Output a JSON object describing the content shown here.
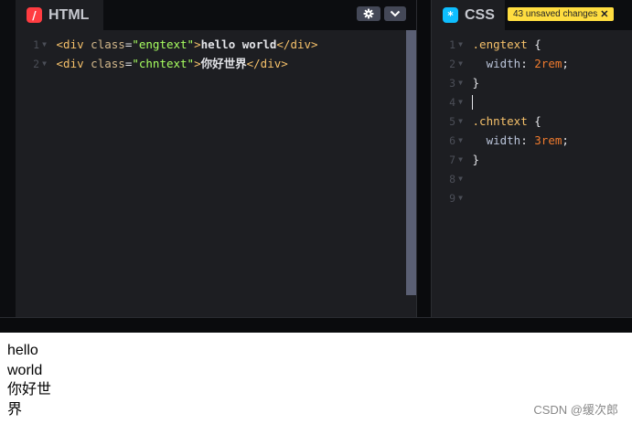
{
  "colors": {
    "tag": "#f5c06a",
    "attr": "#d4b98c",
    "string": "#a8ff60",
    "selector": "#f5c06a",
    "property": "#b9c3d8",
    "value": "#f07b2e",
    "punct": "#e4e5e9",
    "brace": "#e4e5e9",
    "text": "#e4e5e9"
  },
  "html_pane": {
    "title": "HTML",
    "icon": "html-slash-icon",
    "settings_icon": "gear-icon",
    "collapse_icon": "chevron-down-icon",
    "lines": [
      {
        "num": "1",
        "tokens": [
          {
            "t": "<div",
            "c": "tag"
          },
          {
            "t": " ",
            "c": "text"
          },
          {
            "t": "class",
            "c": "attr"
          },
          {
            "t": "=",
            "c": "punct"
          },
          {
            "t": "\"engtext\"",
            "c": "string"
          },
          {
            "t": ">",
            "c": "tag"
          },
          {
            "t": "hello world",
            "c": "text"
          },
          {
            "t": "</div>",
            "c": "tag"
          }
        ]
      },
      {
        "num": "2",
        "tokens": [
          {
            "t": "<div",
            "c": "tag"
          },
          {
            "t": " ",
            "c": "text"
          },
          {
            "t": "class",
            "c": "attr"
          },
          {
            "t": "=",
            "c": "punct"
          },
          {
            "t": "\"chntext\"",
            "c": "string"
          },
          {
            "t": ">",
            "c": "tag"
          },
          {
            "t": "你好世界",
            "c": "text"
          },
          {
            "t": "</div>",
            "c": "tag"
          }
        ]
      }
    ]
  },
  "css_pane": {
    "title": "CSS",
    "icon": "css-asterisk-icon",
    "unsaved_badge": "43 unsaved changes",
    "badge_close": "✕",
    "lines": [
      {
        "num": "1",
        "fold": true,
        "tokens": [
          {
            "t": ".engtext",
            "c": "selector"
          },
          {
            "t": " {",
            "c": "brace"
          }
        ]
      },
      {
        "num": "2",
        "tokens": [
          {
            "t": "  width",
            "c": "property"
          },
          {
            "t": ": ",
            "c": "punct"
          },
          {
            "t": "2rem",
            "c": "value"
          },
          {
            "t": ";",
            "c": "punct"
          }
        ]
      },
      {
        "num": "3",
        "tokens": [
          {
            "t": "}",
            "c": "brace"
          }
        ]
      },
      {
        "num": "4",
        "cursor": true,
        "tokens": []
      },
      {
        "num": "5",
        "fold": true,
        "tokens": [
          {
            "t": ".chntext",
            "c": "selector"
          },
          {
            "t": " {",
            "c": "brace"
          }
        ]
      },
      {
        "num": "6",
        "tokens": [
          {
            "t": "  width",
            "c": "property"
          },
          {
            "t": ": ",
            "c": "punct"
          },
          {
            "t": "3rem",
            "c": "value"
          },
          {
            "t": ";",
            "c": "punct"
          }
        ]
      },
      {
        "num": "7",
        "tokens": [
          {
            "t": "}",
            "c": "brace"
          }
        ]
      },
      {
        "num": "8",
        "tokens": []
      },
      {
        "num": "9",
        "tokens": []
      }
    ]
  },
  "preview": {
    "eng_lines": [
      "hello",
      "world"
    ],
    "chn_lines": [
      "你好世",
      "界"
    ]
  },
  "watermark": "CSDN @缓次郎"
}
